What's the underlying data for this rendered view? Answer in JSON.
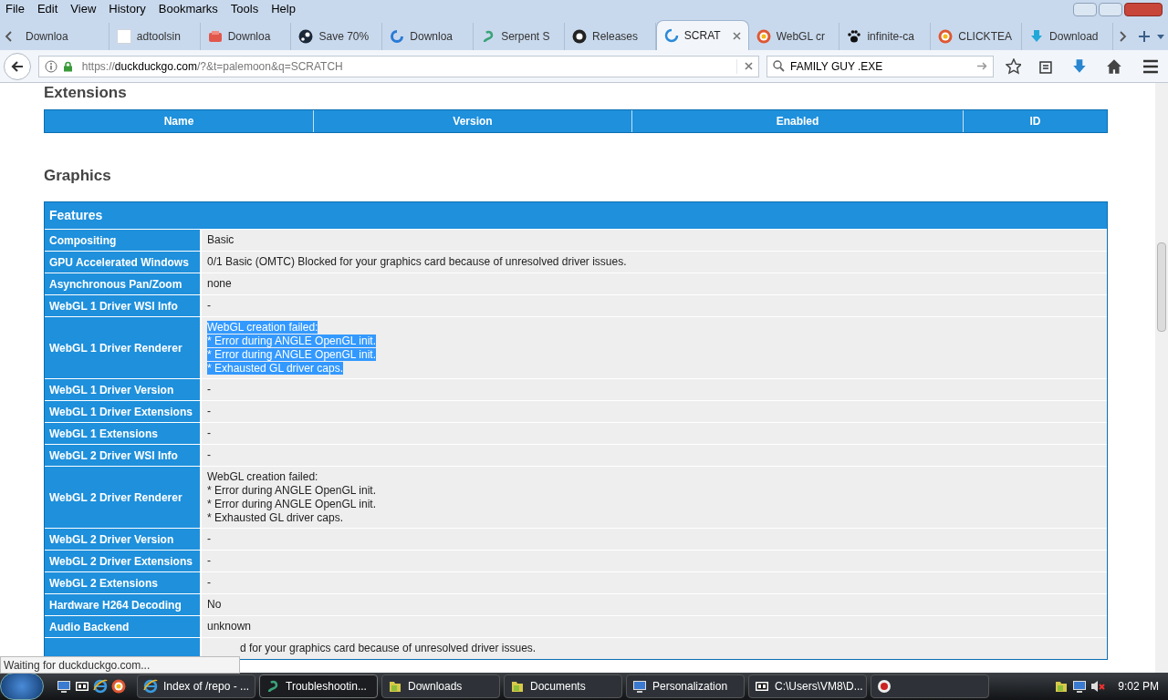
{
  "menu": [
    "File",
    "Edit",
    "View",
    "History",
    "Bookmarks",
    "Tools",
    "Help"
  ],
  "tabs": [
    {
      "title": "Downloa",
      "selected": false
    },
    {
      "title": "adtoolsin",
      "selected": false
    },
    {
      "title": "Downloa",
      "selected": false
    },
    {
      "title": "Save 70%",
      "selected": false
    },
    {
      "title": "Downloa",
      "selected": false
    },
    {
      "title": "Serpent S",
      "selected": false
    },
    {
      "title": "Releases",
      "selected": false
    },
    {
      "title": "SCRAT",
      "selected": true
    },
    {
      "title": "WebGL cr",
      "selected": false
    },
    {
      "title": "infinite-ca",
      "selected": false
    },
    {
      "title": "CLICKTEA",
      "selected": false
    },
    {
      "title": "Download",
      "selected": false
    }
  ],
  "address": {
    "scheme": "https://",
    "host": "duckduckgo.com",
    "rest": "/?&t=palemoon&q=SCRATCH"
  },
  "search": {
    "value": "FAMILY GUY .EXE"
  },
  "extensions": {
    "heading": "Extensions",
    "columns": [
      "Name",
      "Version",
      "Enabled",
      "ID"
    ]
  },
  "graphics": {
    "heading": "Graphics",
    "table_title": "Features",
    "rows": [
      {
        "label": "Compositing",
        "lines": [
          "Basic"
        ],
        "selected": false
      },
      {
        "label": "GPU Accelerated Windows",
        "lines": [
          "0/1 Basic (OMTC) Blocked for your graphics card because of unresolved driver issues."
        ],
        "selected": false
      },
      {
        "label": "Asynchronous Pan/Zoom",
        "lines": [
          "none"
        ],
        "selected": false
      },
      {
        "label": "WebGL 1 Driver WSI Info",
        "lines": [
          "-"
        ],
        "selected": false
      },
      {
        "label": "WebGL 1 Driver Renderer",
        "lines": [
          "WebGL creation failed:",
          "* Error during ANGLE OpenGL init.",
          "* Error during ANGLE OpenGL init.",
          "* Exhausted GL driver caps."
        ],
        "selected": true
      },
      {
        "label": "WebGL 1 Driver Version",
        "lines": [
          "-"
        ],
        "selected": false
      },
      {
        "label": "WebGL 1 Driver Extensions",
        "lines": [
          "-"
        ],
        "selected": false
      },
      {
        "label": "WebGL 1 Extensions",
        "lines": [
          "-"
        ],
        "selected": false
      },
      {
        "label": "WebGL 2 Driver WSI Info",
        "lines": [
          "-"
        ],
        "selected": false
      },
      {
        "label": "WebGL 2 Driver Renderer",
        "lines": [
          "WebGL creation failed:",
          "* Error during ANGLE OpenGL init.",
          "* Error during ANGLE OpenGL init.",
          "* Exhausted GL driver caps."
        ],
        "selected": false
      },
      {
        "label": "WebGL 2 Driver Version",
        "lines": [
          "-"
        ],
        "selected": false
      },
      {
        "label": "WebGL 2 Driver Extensions",
        "lines": [
          "-"
        ],
        "selected": false
      },
      {
        "label": "WebGL 2 Extensions",
        "lines": [
          "-"
        ],
        "selected": false
      },
      {
        "label": "Hardware H264 Decoding",
        "lines": [
          "No"
        ],
        "selected": false
      },
      {
        "label": "Audio Backend",
        "lines": [
          "unknown"
        ],
        "selected": false
      },
      {
        "lines": [
          "d for your graphics card because of unresolved driver issues."
        ],
        "selected": false
      }
    ]
  },
  "status": "Waiting for duckduckgo.com...",
  "taskbar": {
    "items": [
      {
        "title": "Index of /repo - ...",
        "selected": false
      },
      {
        "title": "Troubleshootin...",
        "selected": true
      },
      {
        "title": "Downloads",
        "selected": false
      },
      {
        "title": "Documents",
        "selected": false
      },
      {
        "title": "Personalization",
        "selected": false
      },
      {
        "title": "C:\\Users\\VM8\\D...",
        "selected": false
      },
      {
        "selected": false
      }
    ],
    "clock": "9:02 PM"
  }
}
